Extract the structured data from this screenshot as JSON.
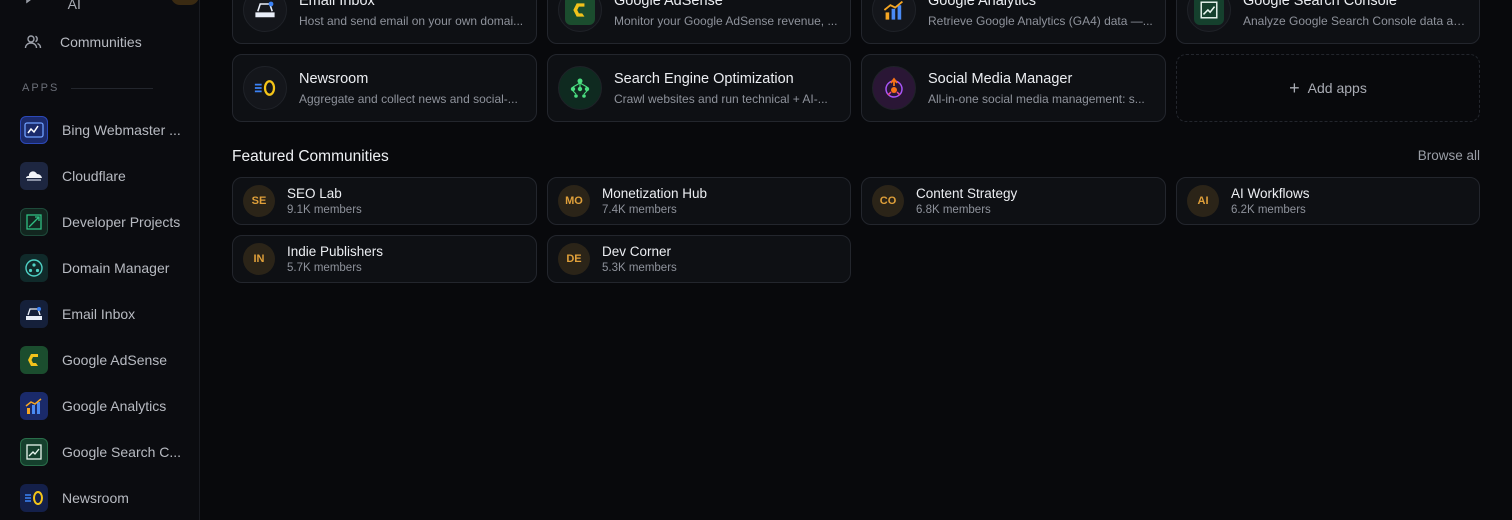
{
  "sidebar": {
    "top_item": {
      "label": "Chat with AI"
    },
    "communities": {
      "label": "Communities"
    },
    "apps_section_label": "APPS",
    "apps": [
      {
        "label": "Bing Webmaster ...",
        "icon": "bing-webmaster-icon"
      },
      {
        "label": "Cloudflare",
        "icon": "cloudflare-icon"
      },
      {
        "label": "Developer Projects",
        "icon": "developer-projects-icon"
      },
      {
        "label": "Domain Manager",
        "icon": "domain-manager-icon"
      },
      {
        "label": "Email Inbox",
        "icon": "email-inbox-icon"
      },
      {
        "label": "Google AdSense",
        "icon": "google-adsense-icon"
      },
      {
        "label": "Google Analytics",
        "icon": "google-analytics-icon"
      },
      {
        "label": "Google Search C...",
        "icon": "google-search-console-icon"
      },
      {
        "label": "Newsroom",
        "icon": "newsroom-icon"
      }
    ]
  },
  "apps_grid": [
    {
      "title": "Email Inbox",
      "desc": "Host and send email on your own domai...",
      "icon": "email-inbox-icon"
    },
    {
      "title": "Google AdSense",
      "desc": "Monitor your Google AdSense revenue, ...",
      "icon": "google-adsense-icon"
    },
    {
      "title": "Google Analytics",
      "desc": "Retrieve Google Analytics (GA4) data —...",
      "icon": "google-analytics-icon"
    },
    {
      "title": "Google Search Console",
      "desc": "Analyze Google Search Console data ac...",
      "icon": "google-search-console-icon"
    },
    {
      "title": "Newsroom",
      "desc": "Aggregate and collect news and social-...",
      "icon": "newsroom-icon"
    },
    {
      "title": "Search Engine Optimization",
      "desc": "Crawl websites and run technical + AI-...",
      "icon": "seo-icon"
    },
    {
      "title": "Social Media Manager",
      "desc": "All-in-one social media management: s...",
      "icon": "social-media-manager-icon"
    }
  ],
  "add_apps_label": "Add apps",
  "featured": {
    "title": "Featured Communities",
    "browse_all": "Browse all",
    "communities": [
      {
        "initials": "SE",
        "name": "SEO Lab",
        "members": "9.1K members"
      },
      {
        "initials": "MO",
        "name": "Monetization Hub",
        "members": "7.4K members"
      },
      {
        "initials": "CO",
        "name": "Content Strategy",
        "members": "6.8K members"
      },
      {
        "initials": "AI",
        "name": "AI Workflows",
        "members": "6.2K members"
      },
      {
        "initials": "IN",
        "name": "Indie Publishers",
        "members": "5.7K members"
      },
      {
        "initials": "DE",
        "name": "Dev Corner",
        "members": "5.3K members"
      }
    ]
  }
}
